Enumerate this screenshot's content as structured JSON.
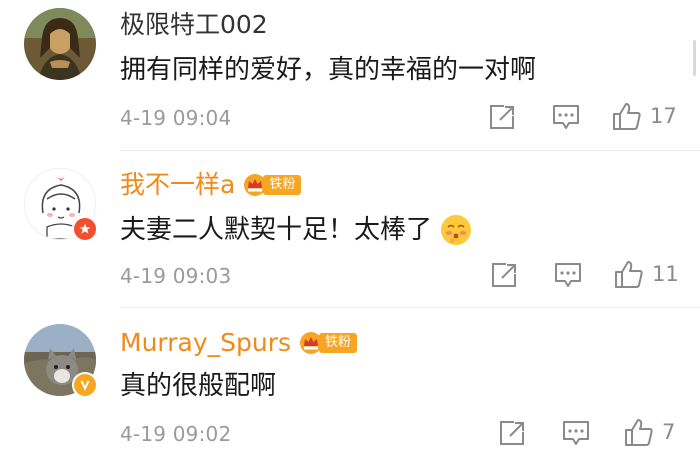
{
  "comments": [
    {
      "username": "极限特工002",
      "text": "拥有同样的爱好，真的幸福的一对啊",
      "time": "4-19 09:04",
      "likes": "17",
      "avatar_icon": "mona-lisa-avatar",
      "name_color": "#333333"
    },
    {
      "username": "我不一样a",
      "badge": "铁粉",
      "text": "夫妻二人默契十足！太棒了",
      "emoji": "shy-face-emoji",
      "time": "4-19 09:03",
      "likes": "11",
      "avatar_icon": "cartoon-girl-avatar",
      "name_color": "#f08a1a"
    },
    {
      "username": "Murray_Spurs",
      "badge": "铁粉",
      "text": "真的很般配啊",
      "time": "4-19 09:02",
      "likes": "7",
      "avatar_icon": "cat-photo-avatar",
      "name_color": "#f08a1a"
    }
  ],
  "colors": {
    "accent_orange": "#f08a1a",
    "badge_bg": "#f6a623",
    "time_gray": "#9a9a9a"
  },
  "icons": [
    "share-icon",
    "comment-icon",
    "like-icon"
  ]
}
